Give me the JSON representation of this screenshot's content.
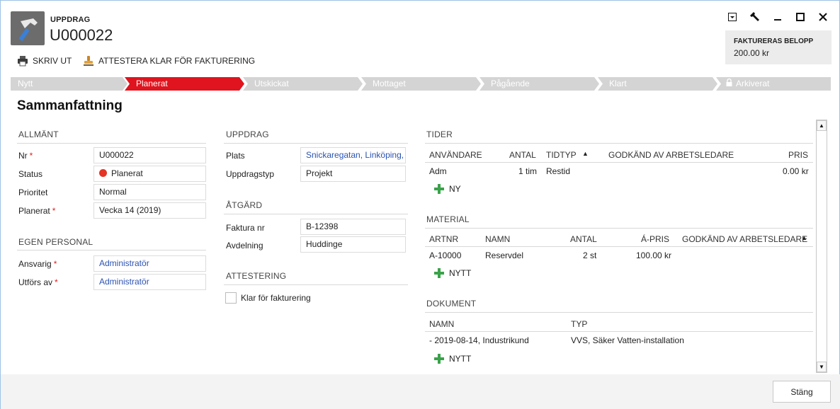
{
  "header": {
    "kicker": "UPPDRAG",
    "record_id": "U000022",
    "app_icon": "hammer-icon"
  },
  "toolbar": {
    "print_label": "SKRIV UT",
    "approve_label": "ATTESTERA KLAR FÖR FAKTURERING"
  },
  "billing": {
    "title": "FAKTURERAS BELOPP",
    "value": "200.00 kr"
  },
  "stages": [
    {
      "label": "Nytt"
    },
    {
      "label": "Planerat"
    },
    {
      "label": "Utskickat"
    },
    {
      "label": "Mottaget"
    },
    {
      "label": "Pågående"
    },
    {
      "label": "Klart"
    },
    {
      "label": "Arkiverat"
    }
  ],
  "page_title": "Sammanfattning",
  "general": {
    "title": "ALLMÄNT",
    "nr_label": "Nr",
    "nr_value": "U000022",
    "status_label": "Status",
    "status_value": "Planerat",
    "priority_label": "Prioritet",
    "priority_value": "Normal",
    "planned_label": "Planerat",
    "planned_value": "Vecka 14 (2019)"
  },
  "own_staff": {
    "title": "EGEN PERSONAL",
    "responsible_label": "Ansvarig",
    "responsible_value": "Administratör",
    "performed_label": "Utförs av",
    "performed_value": "Administratör"
  },
  "assignment": {
    "title": "UPPDRAG",
    "place_label": "Plats",
    "place_value": "Snickaregatan, Linköping,",
    "type_label": "Uppdragstyp",
    "type_value": "Projekt"
  },
  "action": {
    "title": "ÅTGÄRD",
    "invoice_label": "Faktura nr",
    "invoice_value": "B-12398",
    "department_label": "Avdelning",
    "department_value": "Huddinge"
  },
  "attest": {
    "title": "ATTESTERING",
    "checkbox_label": "Klar för fakturering"
  },
  "times": {
    "title": "TIDER",
    "columns": [
      "ANVÄNDARE",
      "ANTAL",
      "TIDTYP",
      "GODKÄND AV ARBETSLEDARE",
      "PRIS"
    ],
    "rows": [
      [
        "Adm",
        "1 tim",
        "Restid",
        "",
        "0.00 kr"
      ]
    ],
    "add_label": "NY"
  },
  "material": {
    "title": "MATERIAL",
    "columns": [
      "ARTNR",
      "NAMN",
      "ANTAL",
      "Á-PRIS",
      "GODKÄND AV ARBETSLEDARE"
    ],
    "rows": [
      [
        "A-10000",
        "Reservdel",
        "2 st",
        "100.00 kr",
        ""
      ]
    ],
    "add_label": "NYTT"
  },
  "documents": {
    "title": "DOKUMENT",
    "columns": [
      "NAMN",
      "TYP"
    ],
    "rows": [
      [
        "- 2019-08-14, Industrikund",
        "VVS, Säker Vatten-installation"
      ]
    ],
    "add_label": "NYTT"
  },
  "footer": {
    "close_label": "Stäng"
  },
  "colors": {
    "active_stage": "#e0141e",
    "inactive_stage": "#d4d4d4",
    "link": "#2b53b3",
    "add_green": "#3aa24a",
    "required": "#dd2222"
  }
}
